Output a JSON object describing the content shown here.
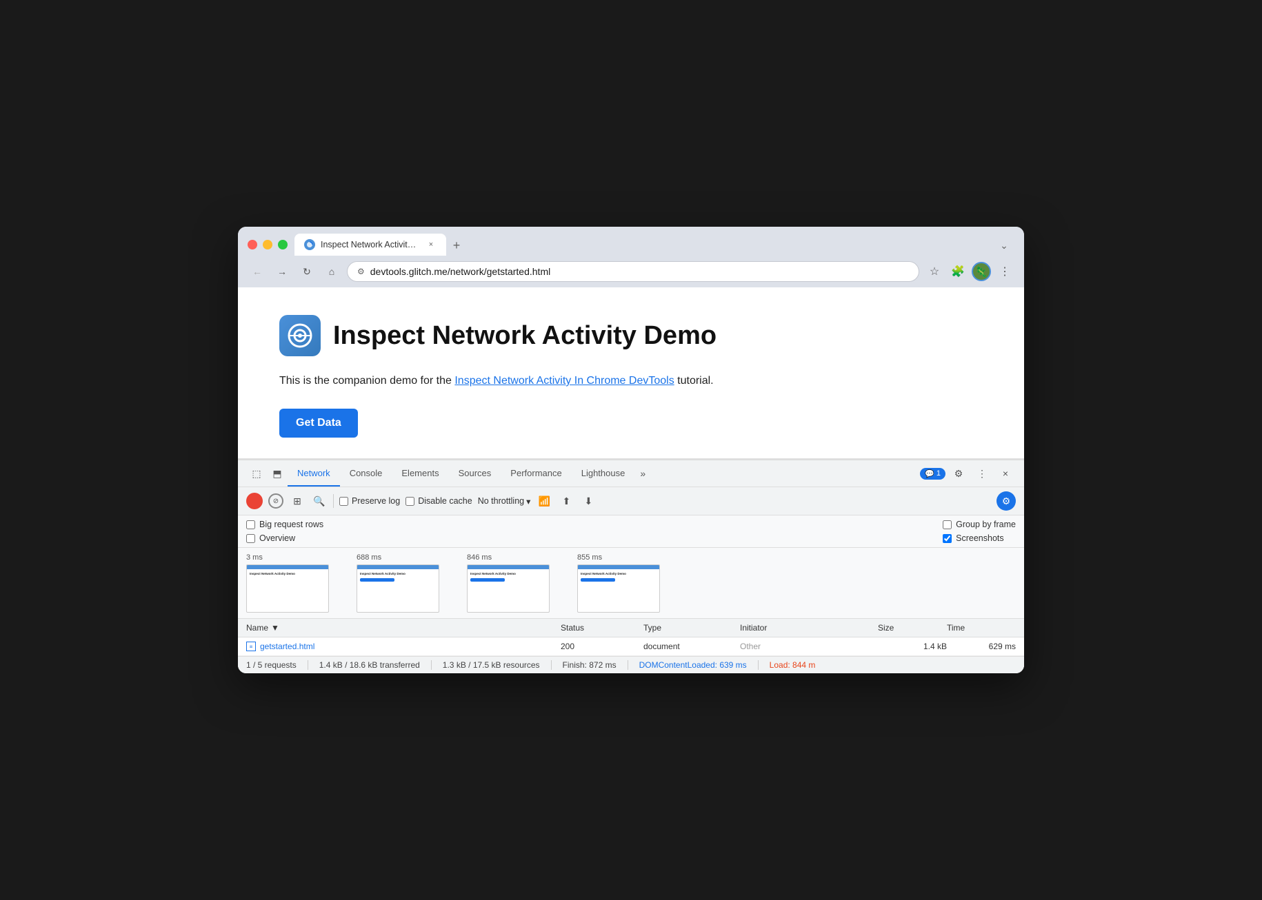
{
  "browser": {
    "tab_title": "Inspect Network Activity Dem",
    "tab_favicon": "🌐",
    "url": "devtools.glitch.me/network/getstarted.html",
    "expand_label": "⌄",
    "close_tab": "×",
    "new_tab": "+"
  },
  "nav": {
    "back_label": "←",
    "forward_label": "→",
    "reload_label": "↻",
    "home_label": "⌂",
    "bookmark_label": "☆",
    "extensions_label": "🧩",
    "menu_label": "⋮"
  },
  "page": {
    "title": "Inspect Network Activity Demo",
    "description_prefix": "This is the companion demo for the ",
    "link_text": "Inspect Network Activity In Chrome DevTools",
    "description_suffix": " tutorial.",
    "button_label": "Get Data"
  },
  "devtools": {
    "icon1": "⬚",
    "icon2": "⬒",
    "tabs": [
      {
        "label": "Network",
        "active": true
      },
      {
        "label": "Console",
        "active": false
      },
      {
        "label": "Elements",
        "active": false
      },
      {
        "label": "Sources",
        "active": false
      },
      {
        "label": "Performance",
        "active": false
      },
      {
        "label": "Lighthouse",
        "active": false
      }
    ],
    "more_tabs": "»",
    "badge_icon": "💬",
    "badge_count": "1",
    "settings_icon": "⚙",
    "more_icon": "⋮",
    "close_icon": "×"
  },
  "network_toolbar": {
    "record_active": true,
    "clear_label": "⊘",
    "filter_label": "⊞",
    "search_label": "🔍",
    "preserve_log_label": "Preserve log",
    "preserve_log_checked": false,
    "disable_cache_label": "Disable cache",
    "disable_cache_checked": false,
    "throttle_label": "No throttling",
    "wifi_icon": "📶",
    "upload_icon": "⬆",
    "download_icon": "⬇",
    "settings_icon": "⚙"
  },
  "options": {
    "big_rows_label": "Big request rows",
    "big_rows_checked": false,
    "overview_label": "Overview",
    "overview_checked": false,
    "group_frame_label": "Group by frame",
    "group_frame_checked": false,
    "screenshots_label": "Screenshots",
    "screenshots_checked": true
  },
  "screenshots": [
    {
      "time": "3 ms",
      "content": "Inspect Network Activity Demo"
    },
    {
      "time": "688 ms",
      "content": "Inspect Network Activity Demo"
    },
    {
      "time": "846 ms",
      "content": "Inspect Network Activity Demo"
    },
    {
      "time": "855 ms",
      "content": "Inspect Network Activity Demo"
    }
  ],
  "table": {
    "columns": [
      "Name",
      "▼",
      "Status",
      "Type",
      "Initiator",
      "Size",
      "Time"
    ],
    "rows": [
      {
        "name": "getstarted.html",
        "status": "200",
        "type": "document",
        "initiator": "Other",
        "size": "1.4 kB",
        "time": "629 ms"
      }
    ]
  },
  "status_bar": {
    "requests": "1 / 5 requests",
    "transferred": "1.4 kB / 18.6 kB transferred",
    "resources": "1.3 kB / 17.5 kB resources",
    "finish": "Finish: 872 ms",
    "dom_loaded": "DOMContentLoaded: 639 ms",
    "load": "Load: 844 m"
  }
}
